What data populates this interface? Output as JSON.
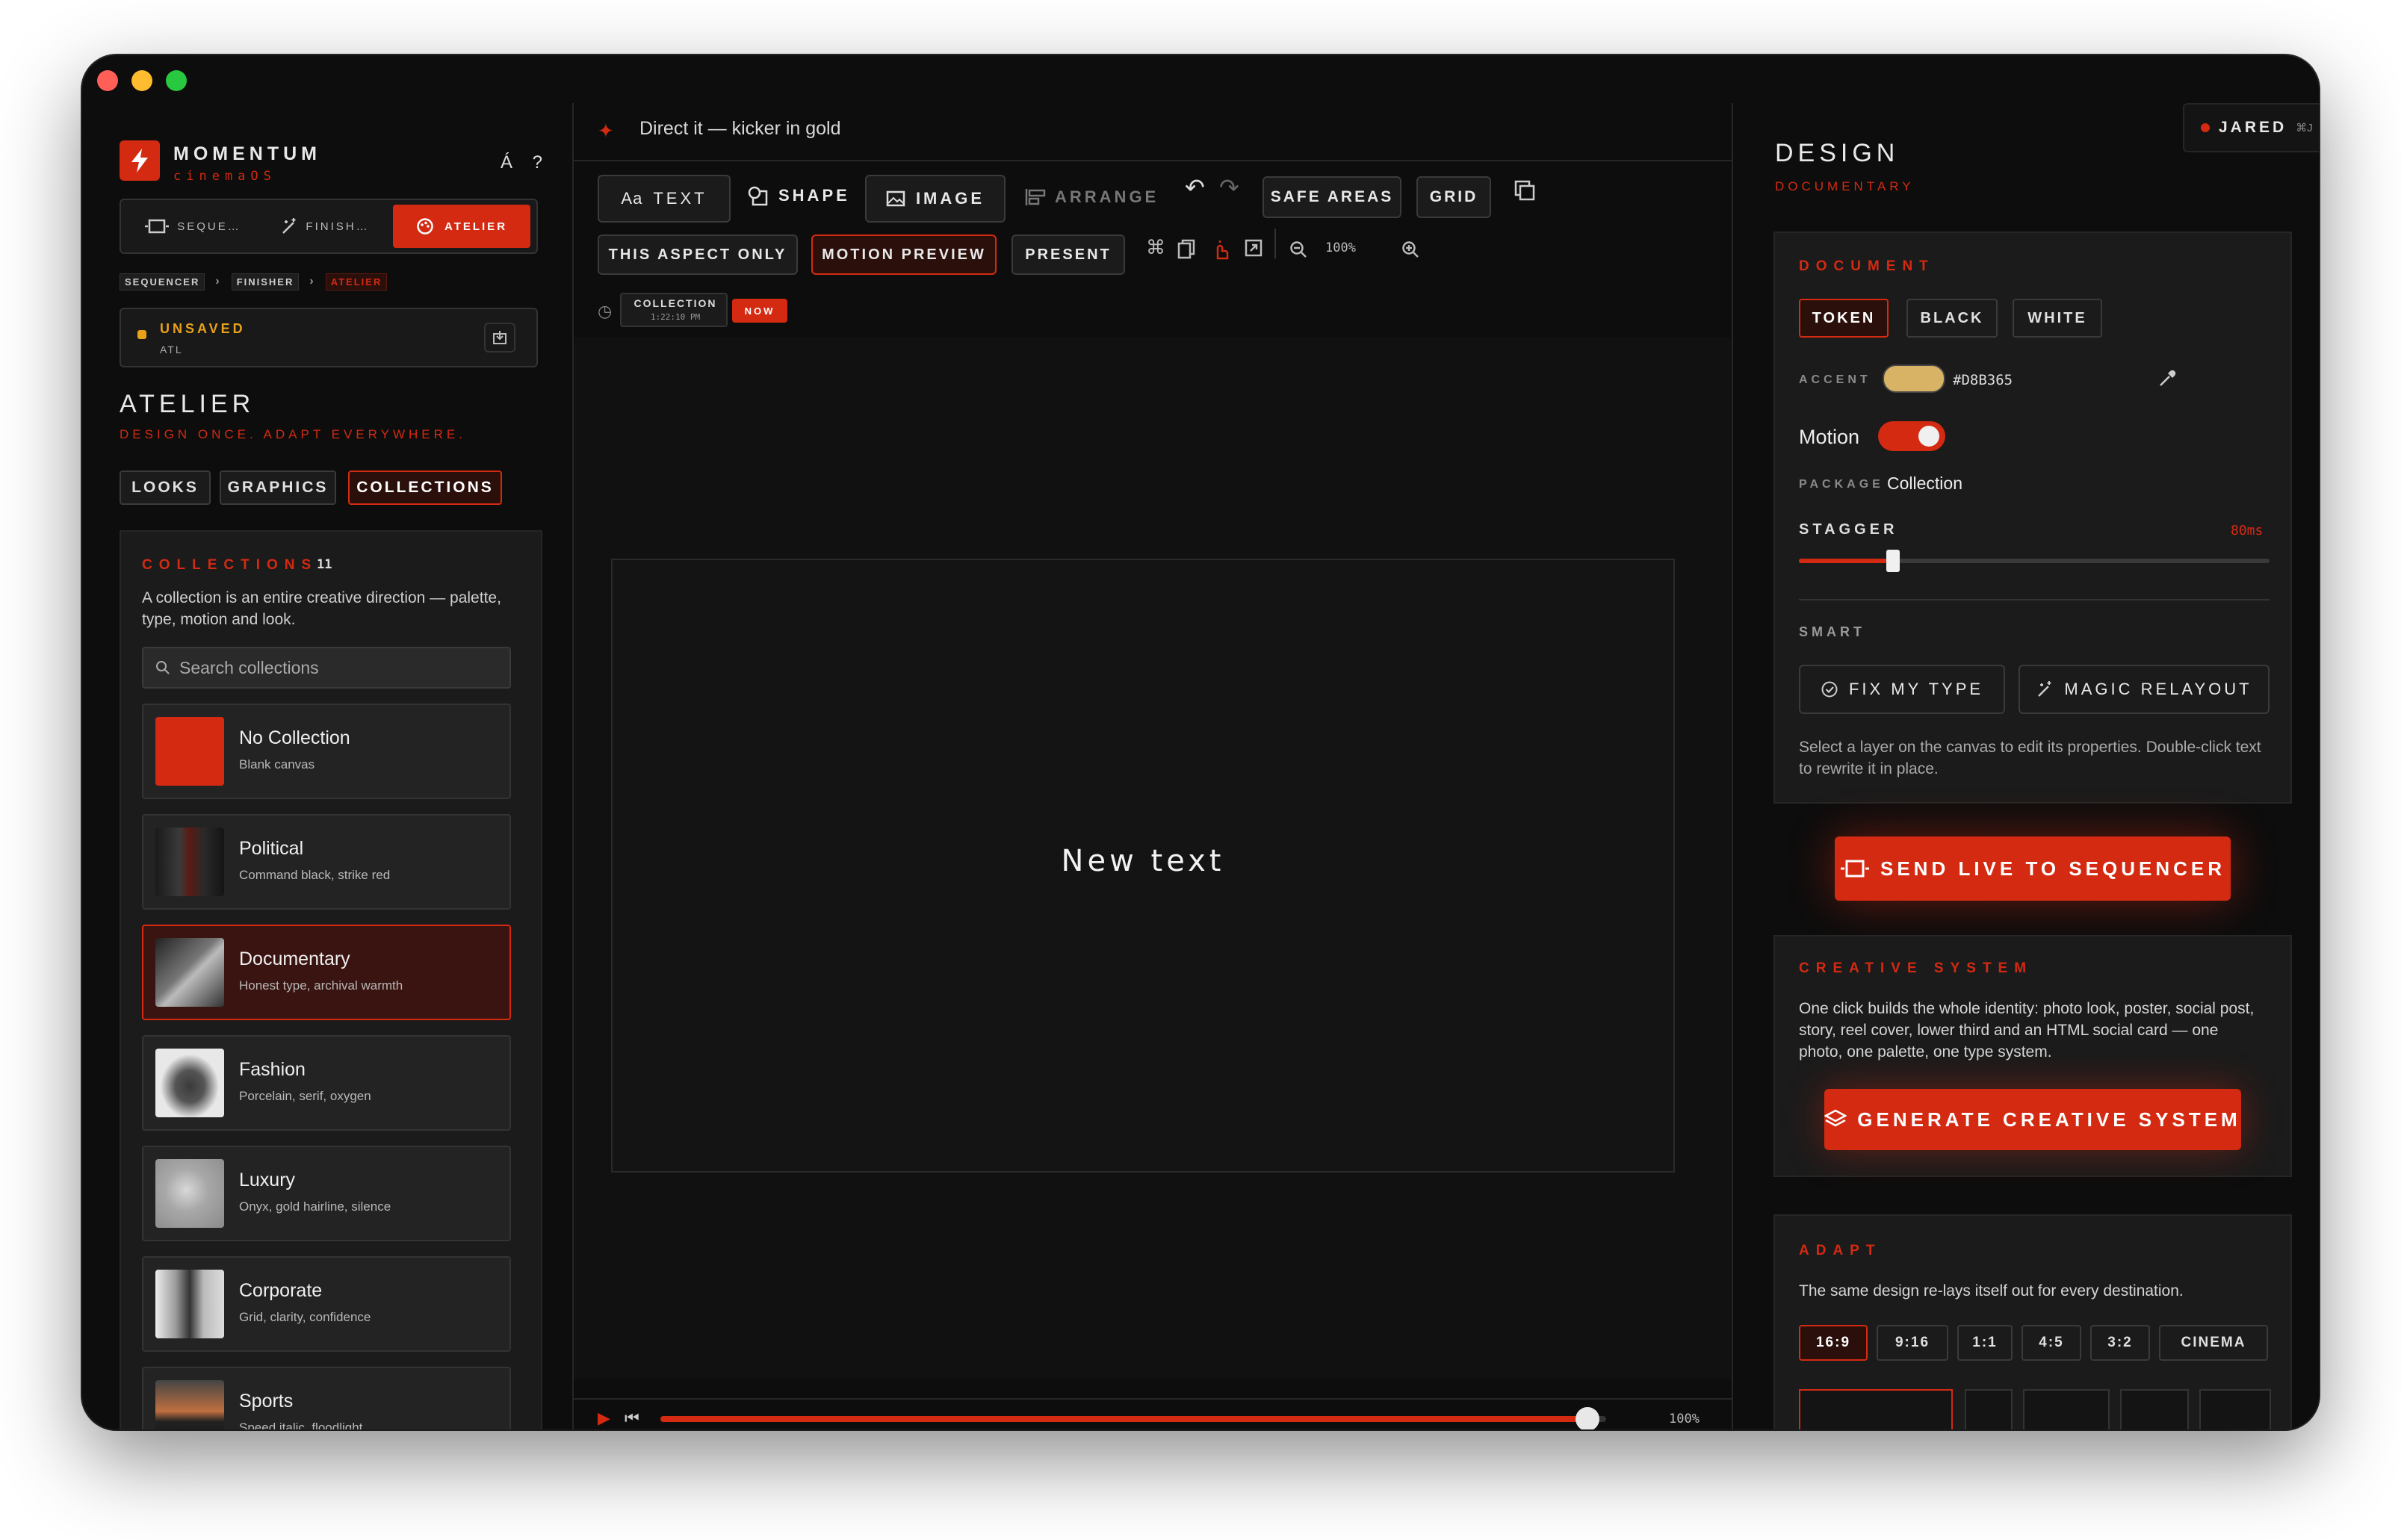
{
  "app": {
    "name": "MOMENTUM",
    "subtitle": "cinemaOS",
    "help": "Á ?"
  },
  "modes": [
    {
      "label": "SEQUE…"
    },
    {
      "label": "FINISH…"
    },
    {
      "label": "ATELIER"
    }
  ],
  "breadcrumb": [
    "SEQUENCER",
    "FINISHER",
    "ATELIER"
  ],
  "status": {
    "title": "UNSAVED",
    "sub": "ATL"
  },
  "atelier": {
    "heading": "ATELIER",
    "tagline": "DESIGN ONCE. ADAPT EVERYWHERE.",
    "tabs": [
      "LOOKS",
      "GRAPHICS",
      "COLLECTIONS"
    ]
  },
  "collections": {
    "caption": "COLLECTIONS",
    "count": "11",
    "description": "A collection is an entire creative direction — palette, type, motion and look.",
    "search_placeholder": "Search collections",
    "items": [
      {
        "title": "No Collection",
        "sub": "Blank canvas"
      },
      {
        "title": "Political",
        "sub": "Command black, strike red"
      },
      {
        "title": "Documentary",
        "sub": "Honest type, archival warmth"
      },
      {
        "title": "Fashion",
        "sub": "Porcelain, serif, oxygen"
      },
      {
        "title": "Luxury",
        "sub": "Onyx, gold hairline, silence"
      },
      {
        "title": "Corporate",
        "sub": "Grid, clarity, confidence"
      },
      {
        "title": "Sports",
        "sub": "Speed italic, floodlight"
      }
    ]
  },
  "editor": {
    "prompt": "Direct it — kicker in gold",
    "toolbar": {
      "text": "TEXT",
      "text_prefix": "Aa",
      "shape": "SHAPE",
      "image": "IMAGE",
      "arrange": "ARRANGE",
      "safe_areas": "SAFE AREAS",
      "grid": "GRID"
    },
    "toolbar2": {
      "aspect": "THIS ASPECT ONLY",
      "motion": "MOTION PREVIEW",
      "present": "PRESENT",
      "zoom": "100%"
    },
    "history": {
      "label": "COLLECTION",
      "time": "1:22:10 PM",
      "now": "NOW"
    },
    "canvas_text": "New text",
    "playback_pct": "100%",
    "progress": 0.98
  },
  "user": {
    "name": "JARED",
    "shortcut": "⌘J"
  },
  "design": {
    "heading": "DESIGN",
    "subtitle": "DOCUMENTARY",
    "document": {
      "caption": "DOCUMENT",
      "modes": [
        "TOKEN",
        "BLACK",
        "WHITE"
      ]
    },
    "accent": {
      "label": "ACCENT",
      "hex": "#D8B365",
      "color": "#D8B365"
    },
    "motion": {
      "label": "Motion",
      "on": true
    },
    "package": {
      "label": "PACKAGE",
      "value": "Collection"
    },
    "stagger": {
      "label": "STAGGER",
      "value": "80ms",
      "fraction": 0.2
    },
    "smart": {
      "label": "SMART",
      "fix": "FIX MY TYPE",
      "relayout": "MAGIC RELAYOUT",
      "help": "Select a layer on the canvas to edit its properties. Double-click text to rewrite it in place."
    },
    "send_live": "SEND LIVE TO SEQUENCER",
    "creative": {
      "caption": "CREATIVE SYSTEM",
      "description": "One click builds the whole identity: photo look, poster, social post, story, reel cover, lower third and an HTML social card — one photo, one palette, one type system.",
      "button": "GENERATE CREATIVE SYSTEM"
    },
    "adapt": {
      "caption": "ADAPT",
      "description": "The same design re-lays itself out for every destination.",
      "ratios": [
        "16:9",
        "9:16",
        "1:1",
        "4:5",
        "3:2",
        "CINEMA"
      ]
    }
  },
  "colors": {
    "accent_red": "#D42A12",
    "background": "#0D0D0D",
    "panel": "#1B1B1B",
    "gold": "#D8B365"
  }
}
